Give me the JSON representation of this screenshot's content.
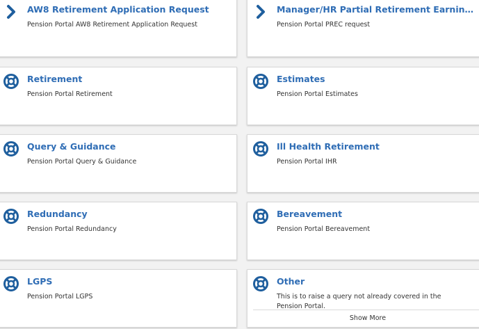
{
  "cards": [
    {
      "icon": "chevron-right-icon",
      "title": "AW8 Retirement Application Request",
      "desc": "Pension Portal AW8 Retirement Application Request"
    },
    {
      "icon": "chevron-right-icon",
      "title": "Manager/HR Partial Retirement Earnings Chec...",
      "desc": "Pension Portal PREC request"
    },
    {
      "icon": "lifebuoy-icon",
      "title": "Retirement",
      "desc": "Pension Portal Retirement"
    },
    {
      "icon": "lifebuoy-icon",
      "title": "Estimates",
      "desc": "Pension Portal Estimates"
    },
    {
      "icon": "lifebuoy-icon",
      "title": "Query & Guidance",
      "desc": "Pension Portal Query & Guidance"
    },
    {
      "icon": "lifebuoy-icon",
      "title": "Ill Health Retirement",
      "desc": "Pension Portal IHR"
    },
    {
      "icon": "lifebuoy-icon",
      "title": "Redundancy",
      "desc": "Pension Portal Redundancy"
    },
    {
      "icon": "lifebuoy-icon",
      "title": "Bereavement",
      "desc": "Pension Portal Bereavement"
    },
    {
      "icon": "lifebuoy-icon",
      "title": "LGPS",
      "desc": "Pension Portal LGPS"
    },
    {
      "icon": "lifebuoy-icon",
      "title": "Other",
      "desc": "This is to raise a query not already covered in the Pension Portal."
    }
  ],
  "show_more_label": "Show More",
  "colors": {
    "title": "#2f6db5",
    "icon": "#1f5f9e",
    "card_bg": "#ffffff",
    "page_bg": "#f2f2f2"
  }
}
